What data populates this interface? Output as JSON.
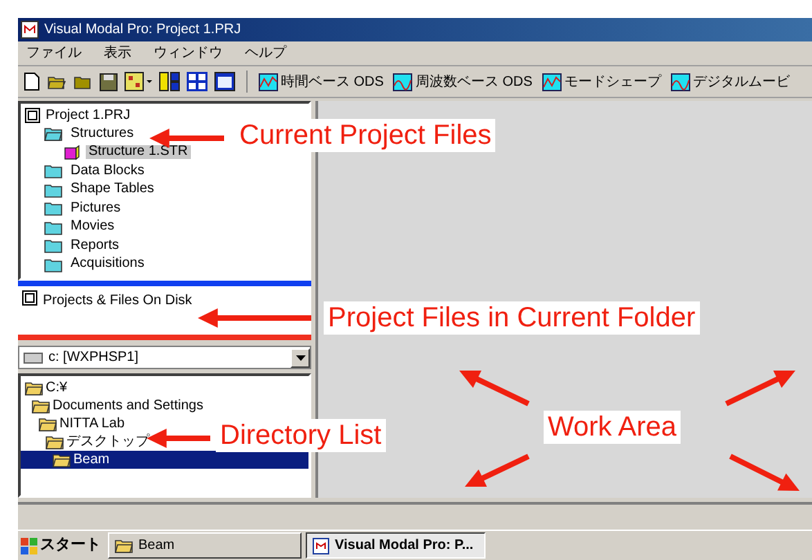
{
  "window": {
    "title": "Visual Modal Pro: Project 1.PRJ"
  },
  "menu": [
    "ファイル",
    "表示",
    "ウィンドウ",
    "ヘルプ"
  ],
  "toolbar": {
    "views": [
      {
        "label": "時間ベース ODS"
      },
      {
        "label": "周波数ベース ODS"
      },
      {
        "label": "モードシェープ"
      },
      {
        "label": "デジタルムービ"
      }
    ]
  },
  "project_tree": {
    "label": "Project 1.PRJ",
    "children": [
      {
        "label": "Structures",
        "expanded": true,
        "selected": false,
        "children": [
          {
            "label": "Structure 1.STR",
            "selected": true
          }
        ]
      },
      {
        "label": "Data Blocks",
        "expanded": false,
        "selected": false
      },
      {
        "label": "Shape Tables",
        "expanded": false,
        "selected": false
      },
      {
        "label": "Pictures",
        "expanded": false,
        "selected": false
      },
      {
        "label": "Movies",
        "expanded": false,
        "selected": false
      },
      {
        "label": "Reports",
        "expanded": false,
        "selected": false
      },
      {
        "label": "Acquisitions",
        "expanded": false,
        "selected": false
      }
    ]
  },
  "disk_panel": {
    "label": "Projects & Files On Disk"
  },
  "drive": {
    "value": "c: [WXPHSP1]"
  },
  "directory": [
    {
      "label": "C:¥",
      "selected": false,
      "children": [
        {
          "label": "Documents and Settings",
          "selected": false,
          "children": [
            {
              "label": "NITTA Lab",
              "selected": false,
              "children": [
                {
                  "label": "デスクトップ",
                  "selected": false,
                  "children": [
                    {
                      "label": "Beam",
                      "selected": true
                    }
                  ]
                }
              ]
            }
          ]
        }
      ]
    }
  ],
  "taskbar": {
    "start": "スタート",
    "items": [
      {
        "label": "Beam",
        "selected": false
      },
      {
        "label": "Visual Modal Pro: P...",
        "selected": true
      }
    ]
  },
  "annotations": [
    {
      "text": "Current Project Files"
    },
    {
      "text": "Project Files in Current Folder"
    },
    {
      "text": "Directory List"
    },
    {
      "text": "Work Area"
    }
  ]
}
